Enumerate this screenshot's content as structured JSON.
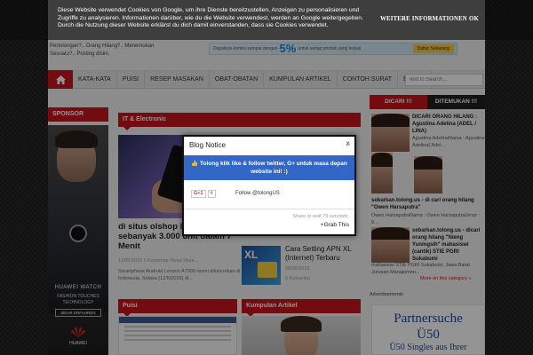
{
  "header": {
    "tagline": "Pertolongan?.. Orang Hilang?.. Menemukan Sesuatu?.. Posting disini.",
    "ad": {
      "pre": "Dapatkan komisi sampai dengan",
      "percent": "5%",
      "post": "untuk setiap produk yang terjual",
      "button": "Daftar Sekarang"
    }
  },
  "nav": {
    "items": [
      "KATA-KATA",
      "PUISI",
      "RESEP MASAKAN",
      "OBAT-OBATAN",
      "KUMPULAN ARTIKEL",
      "CONTOH SURAT",
      "BERITA"
    ],
    "search_placeholder": "Text to Search..."
  },
  "sponsor": {
    "title": "SPONSOR",
    "line1": "HUAWEI WATCH",
    "line2a": "FASHION TOUCHES",
    "line2b": "TECHNOLOGY",
    "button": "MEHR ERFAHREN",
    "brand": "HUAWEI"
  },
  "it": {
    "title": "IT & Electronic",
    "big_title": "di situs olshop lazada Ludes sebanyak 3.000 unit dalam 7 Menit",
    "big_meta": "11/05/2015   0 Komentar   Read More...",
    "big_snippet": "Smartphone Android Lenovo A7000 resmi diluncurkan di Indonesia, Selasa (12/5/2015) di...",
    "small_title": "Cara Setting APN XL (Internet) Terbaru",
    "small_date": "28/05/2015",
    "small_comments": "0 Komentar",
    "xl_label": "XL"
  },
  "right": {
    "tab_dicari": "DICARI !!!",
    "tab_ditemukan": "DITEMUKAN !!!",
    "items": [
      {
        "title": "DICARI ORANG HILANG : Agustina Adelina (ADEL / LINA)",
        "text": "Agustina AdelinaNama : Agustina Adelina( Adel..."
      },
      {
        "title": "sebarkan.tolong.us - di cari orang hilang \"Owen Harsaputra\"",
        "text": "Owen HarsaputraNama : Owen HarsaputraUmur : 9..."
      },
      {
        "title": "sebarkan.tolong.us - dicari orang hilang \"Nieng Yuningsih\" mahasiswi (cantik) STIE PGRI Sukabumi",
        "text": "mahasiswi STIE PGRI Sukabumi, Jawa Barat Jurusan Manajemen..."
      }
    ],
    "more": "More on this category »",
    "ads_label": "Advertisements",
    "partner": {
      "line1": "Partnersuche",
      "line2": "Ü50",
      "line3": "Ü50 Singles aus Ihrer"
    }
  },
  "bottom": {
    "puisi": "Puisi",
    "kumpulan": "Kumpulan Artikel"
  },
  "cookie": {
    "text": "Diese Website verwendet Cookies von Google, um ihre Dienste bereitzustellen, Anzeigen zu personalisieren und Zugriffe zu analysieren. Informationen darüber, wie du die Website verwendest, werden an Google weitergegeben. Durch die Nutzung dieser Website erklärst du dich damit einverstanden, dass sie Cookies verwendet.",
    "more_info": "WEITERE INFORMATIONEN",
    "ok": "OK"
  },
  "modal": {
    "title": "Blog Notice",
    "close": "x",
    "message": "Tolong klik like & follow twitter, G+ untuk masa depan website ini! :)",
    "gplus": "G+1",
    "gplus_count": "4",
    "follow": "Follow @tolongUS",
    "wait": "Share or wait 79 seconds.",
    "grab": "+Grab This"
  },
  "colors": {
    "accent": "#c4161c",
    "modal_band": "#3367c7"
  }
}
